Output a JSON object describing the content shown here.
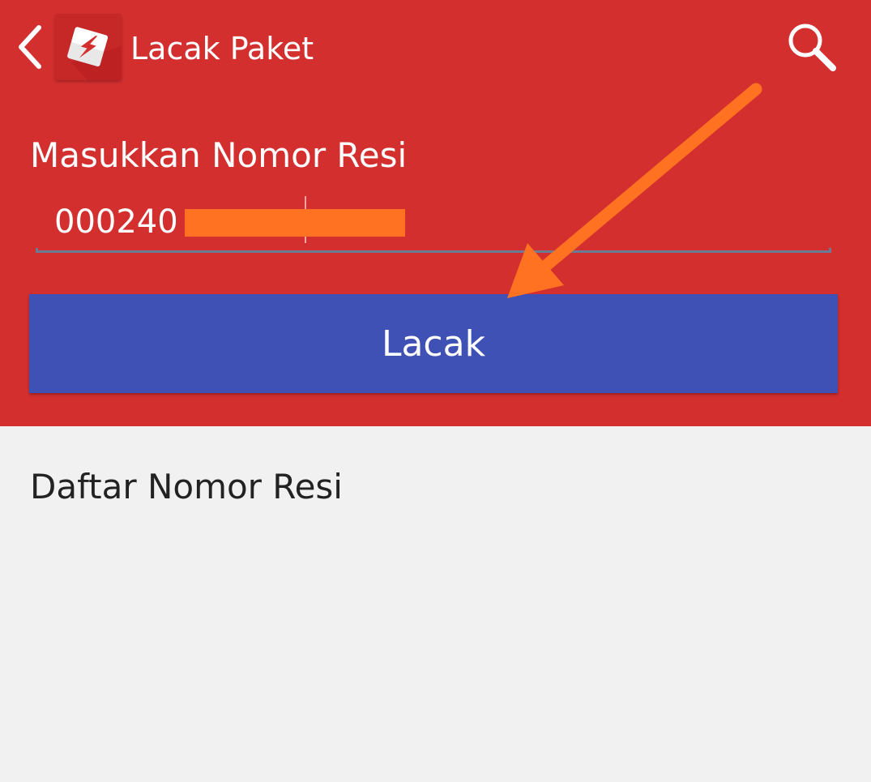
{
  "toolbar": {
    "back_icon": "chevron-left-icon",
    "logo_icon": "app-logo-icon",
    "title": "Lacak Paket",
    "search_icon": "search-icon"
  },
  "form": {
    "label": "Masukkan Nomor Resi",
    "input_value": "00024",
    "input_value_tail": "0",
    "submit_label": "Lacak"
  },
  "list": {
    "heading": "Daftar Nomor Resi"
  },
  "colors": {
    "header_background": "#d32f2f",
    "button_background": "#3f51b5",
    "body_background": "#f1f1f1",
    "annotation": "#ff7222"
  }
}
